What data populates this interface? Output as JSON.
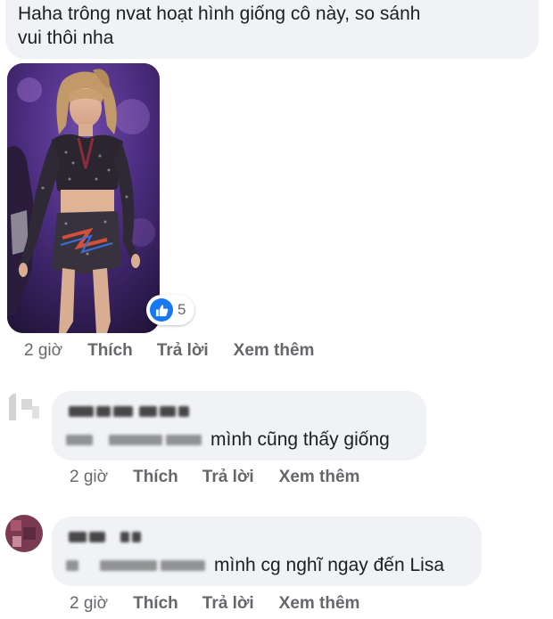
{
  "top_comment": {
    "text_line1": "Haha trông nvat hoạt hình giống cô này, so sánh",
    "text_line2": "vui thôi nha",
    "reaction": {
      "icon": "like-icon",
      "count": "5",
      "color": "#1877f2"
    },
    "meta": {
      "time": "2 giờ",
      "like_label": "Thích",
      "reply_label": "Trả lời",
      "more_label": "Xem thêm"
    }
  },
  "replies": [
    {
      "author_name": "",
      "mention": "",
      "text": "mình cũng thấy giống",
      "meta": {
        "time": "2 giờ",
        "like_label": "Thích",
        "reply_label": "Trả lời",
        "more_label": "Xem thêm"
      }
    },
    {
      "author_name": "",
      "mention": "",
      "text": "mình cg nghĩ ngay đến Lisa",
      "meta": {
        "time": "2 giờ",
        "like_label": "Thích",
        "reply_label": "Trả lời",
        "more_label": "Xem thêm"
      }
    }
  ],
  "colors": {
    "bubble_bg": "#f0f2f5",
    "meta_text": "#65676b",
    "like_blue": "#1877f2"
  }
}
